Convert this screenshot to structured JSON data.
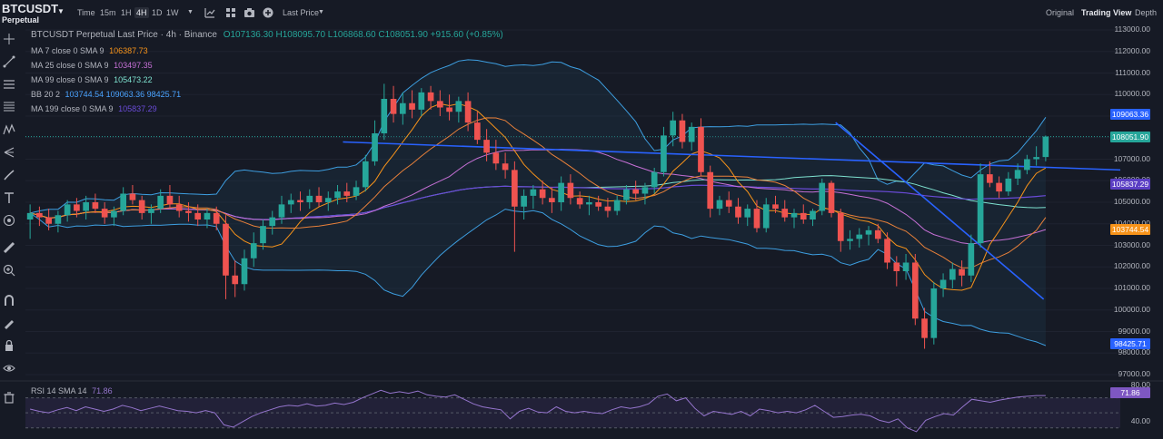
{
  "header": {
    "symbol": "BTCUSDT",
    "subtitle": "Perpetual",
    "timeframes": [
      "Time",
      "15m",
      "1H",
      "4H",
      "1D",
      "1W"
    ],
    "active_timeframe": "4H",
    "price_type": "Last Price",
    "views": [
      "Original",
      "Trading View",
      "Depth"
    ],
    "active_view": "Trading View"
  },
  "legend": {
    "title": "BTCUSDT Perpetual Last Price · 4h · Binance",
    "ohlc": "O107136.30 H108095.70 L106868.60 C108051.90 +915.60 (+0.85%)",
    "indicators": [
      {
        "label": "MA 7 close 0 SMA 9",
        "value": "106387.73",
        "color": "#f7931a"
      },
      {
        "label": "MA 25 close 0 SMA 9",
        "value": "103497.35",
        "color": "#c670d6"
      },
      {
        "label": "MA 99 close 0 SMA 9",
        "value": "105473.22",
        "color": "#7ee2d0"
      },
      {
        "label": "BB 20 2",
        "value": "103744.54  109063.36  98425.71",
        "color": "#f7931a"
      },
      {
        "label": "MA 199 close 0 SMA 9",
        "value": "105837.29",
        "color": "#6a4bd8"
      }
    ]
  },
  "price_axis": {
    "ticks": [
      "113000.00",
      "112000.00",
      "111000.00",
      "110000.00",
      "109000.00",
      "108000.00",
      "107000.00",
      "106000.00",
      "105000.00",
      "104000.00",
      "103000.00",
      "102000.00",
      "101000.00",
      "100000.00",
      "99000.00",
      "98000.00",
      "97000.00"
    ],
    "badges": [
      {
        "value": "109063.36",
        "price": 109063.36,
        "color": "#2962ff"
      },
      {
        "value": "108051.90",
        "price": 108051.9,
        "color": "#26a69a"
      },
      {
        "value": "105837.29",
        "price": 105837.29,
        "color": "#5b3fc4"
      },
      {
        "value": "103744.54",
        "price": 103744.54,
        "color": "#f7931a"
      },
      {
        "value": "98425.71",
        "price": 98425.71,
        "color": "#2962ff"
      }
    ]
  },
  "rsi": {
    "label": "RSI 14 SMA 14",
    "value": "71.86",
    "ticks": [
      "80.00",
      "40.00"
    ]
  },
  "chart_data": {
    "type": "candlestick",
    "y_range": [
      97000,
      113000
    ],
    "candles": [
      [
        104200,
        104900,
        103300,
        104500
      ],
      [
        104500,
        104800,
        103900,
        104300
      ],
      [
        104300,
        104700,
        103700,
        104000
      ],
      [
        104000,
        104600,
        103600,
        104400
      ],
      [
        104400,
        105100,
        104100,
        104900
      ],
      [
        104900,
        105200,
        104300,
        104600
      ],
      [
        104600,
        105300,
        104200,
        105000
      ],
      [
        105000,
        105400,
        104500,
        104700
      ],
      [
        104700,
        105000,
        104000,
        104300
      ],
      [
        104300,
        104800,
        103900,
        104600
      ],
      [
        104600,
        105700,
        104400,
        105400
      ],
      [
        105400,
        105800,
        104900,
        105100
      ],
      [
        105100,
        105300,
        104200,
        104500
      ],
      [
        104500,
        104900,
        104000,
        104700
      ],
      [
        104700,
        105600,
        104500,
        105300
      ],
      [
        105300,
        105800,
        104700,
        104900
      ],
      [
        104900,
        105300,
        104300,
        104600
      ],
      [
        104600,
        105000,
        104100,
        104500
      ],
      [
        104500,
        104900,
        103900,
        104200
      ],
      [
        104200,
        104700,
        103800,
        104500
      ],
      [
        104500,
        104800,
        103700,
        104000
      ],
      [
        104000,
        104400,
        100500,
        101600
      ],
      [
        101600,
        102300,
        100600,
        101200
      ],
      [
        101200,
        102800,
        100900,
        102400
      ],
      [
        102400,
        103600,
        102000,
        103100
      ],
      [
        103100,
        104200,
        102800,
        103900
      ],
      [
        103900,
        104600,
        103500,
        104300
      ],
      [
        104300,
        105300,
        104000,
        104900
      ],
      [
        104900,
        105400,
        104500,
        105100
      ],
      [
        105100,
        105500,
        104600,
        105000
      ],
      [
        105000,
        105600,
        104700,
        105300
      ],
      [
        105300,
        105700,
        104800,
        105000
      ],
      [
        105000,
        105500,
        104600,
        105200
      ],
      [
        105200,
        105800,
        104900,
        105500
      ],
      [
        105500,
        105900,
        105000,
        105300
      ],
      [
        105300,
        106000,
        105100,
        105700
      ],
      [
        105700,
        107200,
        105500,
        106900
      ],
      [
        106900,
        108800,
        106700,
        108200
      ],
      [
        108200,
        110500,
        107900,
        109800
      ],
      [
        109800,
        110400,
        108700,
        109100
      ],
      [
        109100,
        110100,
        108600,
        109600
      ],
      [
        109600,
        110200,
        108900,
        109300
      ],
      [
        109300,
        110300,
        109000,
        110100
      ],
      [
        110100,
        110400,
        109300,
        109700
      ],
      [
        109700,
        110200,
        109000,
        109400
      ],
      [
        109400,
        110000,
        108800,
        109200
      ],
      [
        109200,
        109900,
        108700,
        109700
      ],
      [
        109700,
        110100,
        108300,
        108700
      ],
      [
        108700,
        109200,
        107700,
        107900
      ],
      [
        107900,
        108400,
        106900,
        107300
      ],
      [
        107300,
        107900,
        106500,
        106800
      ],
      [
        106800,
        107300,
        106100,
        106500
      ],
      [
        106500,
        106900,
        102700,
        104800
      ],
      [
        104800,
        105600,
        104200,
        105300
      ],
      [
        105300,
        105800,
        104700,
        105600
      ],
      [
        105600,
        106000,
        104900,
        105200
      ],
      [
        105200,
        105700,
        104500,
        105000
      ],
      [
        105000,
        106200,
        104600,
        105900
      ],
      [
        105900,
        106300,
        104900,
        105200
      ],
      [
        105200,
        105500,
        104700,
        104900
      ],
      [
        104900,
        105300,
        104400,
        105000
      ],
      [
        105000,
        105300,
        104600,
        104800
      ],
      [
        104800,
        105200,
        104300,
        104600
      ],
      [
        104600,
        105300,
        104400,
        105100
      ],
      [
        105100,
        105800,
        104900,
        105600
      ],
      [
        105600,
        106000,
        105100,
        105400
      ],
      [
        105400,
        105900,
        104900,
        105700
      ],
      [
        105700,
        106600,
        105400,
        106400
      ],
      [
        106400,
        108500,
        106200,
        108100
      ],
      [
        108100,
        109200,
        107600,
        108800
      ],
      [
        108800,
        109100,
        107500,
        107800
      ],
      [
        107800,
        108700,
        107400,
        108500
      ],
      [
        108500,
        108900,
        106200,
        106400
      ],
      [
        106400,
        106700,
        104300,
        104700
      ],
      [
        104700,
        105300,
        104400,
        105100
      ],
      [
        105100,
        105500,
        104500,
        104800
      ],
      [
        104800,
        105200,
        104000,
        104300
      ],
      [
        104300,
        104900,
        103900,
        104700
      ],
      [
        104700,
        105100,
        103600,
        103800
      ],
      [
        103800,
        105200,
        103600,
        104900
      ],
      [
        104900,
        105300,
        104500,
        104700
      ],
      [
        104700,
        105100,
        104100,
        104300
      ],
      [
        104300,
        104700,
        103800,
        104500
      ],
      [
        104500,
        104900,
        104000,
        104200
      ],
      [
        104200,
        104700,
        103900,
        104600
      ],
      [
        104600,
        106100,
        104400,
        105900
      ],
      [
        105900,
        106000,
        104300,
        104500
      ],
      [
        104500,
        104700,
        102700,
        103200
      ],
      [
        103200,
        103700,
        102800,
        103300
      ],
      [
        103300,
        103800,
        102900,
        103500
      ],
      [
        103500,
        103900,
        103000,
        103700
      ],
      [
        103700,
        104000,
        103100,
        103300
      ],
      [
        103300,
        103600,
        101900,
        102200
      ],
      [
        102200,
        102500,
        101100,
        101800
      ],
      [
        101800,
        102600,
        101400,
        102200
      ],
      [
        102200,
        102600,
        99300,
        99600
      ],
      [
        99600,
        100100,
        98200,
        98700
      ],
      [
        98700,
        101300,
        98400,
        101000
      ],
      [
        101000,
        101700,
        100600,
        101400
      ],
      [
        101400,
        102200,
        101000,
        101900
      ],
      [
        101900,
        102300,
        101100,
        101600
      ],
      [
        101600,
        103500,
        101300,
        103100
      ],
      [
        103100,
        106800,
        102900,
        106300
      ],
      [
        106300,
        106900,
        105700,
        105900
      ],
      [
        105900,
        106200,
        105200,
        105500
      ],
      [
        105500,
        106400,
        105300,
        106100
      ],
      [
        106100,
        106800,
        105800,
        106500
      ],
      [
        106500,
        107200,
        106300,
        107000
      ],
      [
        107000,
        107600,
        106700,
        107100
      ],
      [
        107100,
        108100,
        106900,
        108050
      ]
    ],
    "trendlines": [
      {
        "from": [
          0.29,
          107800
        ],
        "to": [
          1.0,
          106500
        ],
        "color": "#2962ff"
      },
      {
        "from": [
          0.74,
          108700
        ],
        "to": [
          0.93,
          100500
        ],
        "color": "#2962ff"
      }
    ],
    "rsi_range": [
      20,
      90
    ],
    "rsi_series": [
      55,
      52,
      50,
      54,
      57,
      53,
      58,
      55,
      52,
      55,
      60,
      57,
      53,
      56,
      59,
      56,
      53,
      52,
      50,
      53,
      50,
      34,
      31,
      38,
      45,
      50,
      54,
      58,
      60,
      59,
      62,
      59,
      60,
      63,
      61,
      64,
      70,
      75,
      80,
      76,
      78,
      76,
      79,
      74,
      72,
      71,
      74,
      68,
      62,
      58,
      56,
      54,
      42,
      52,
      56,
      51,
      50,
      58,
      52,
      50,
      52,
      50,
      49,
      54,
      58,
      56,
      58,
      62,
      72,
      75,
      66,
      70,
      56,
      46,
      52,
      50,
      48,
      52,
      46,
      55,
      53,
      50,
      52,
      50,
      54,
      60,
      52,
      44,
      45,
      47,
      48,
      46,
      40,
      37,
      42,
      30,
      25,
      40,
      45,
      49,
      47,
      58,
      68,
      66,
      64,
      67,
      69,
      71,
      72,
      73,
      73
    ]
  }
}
